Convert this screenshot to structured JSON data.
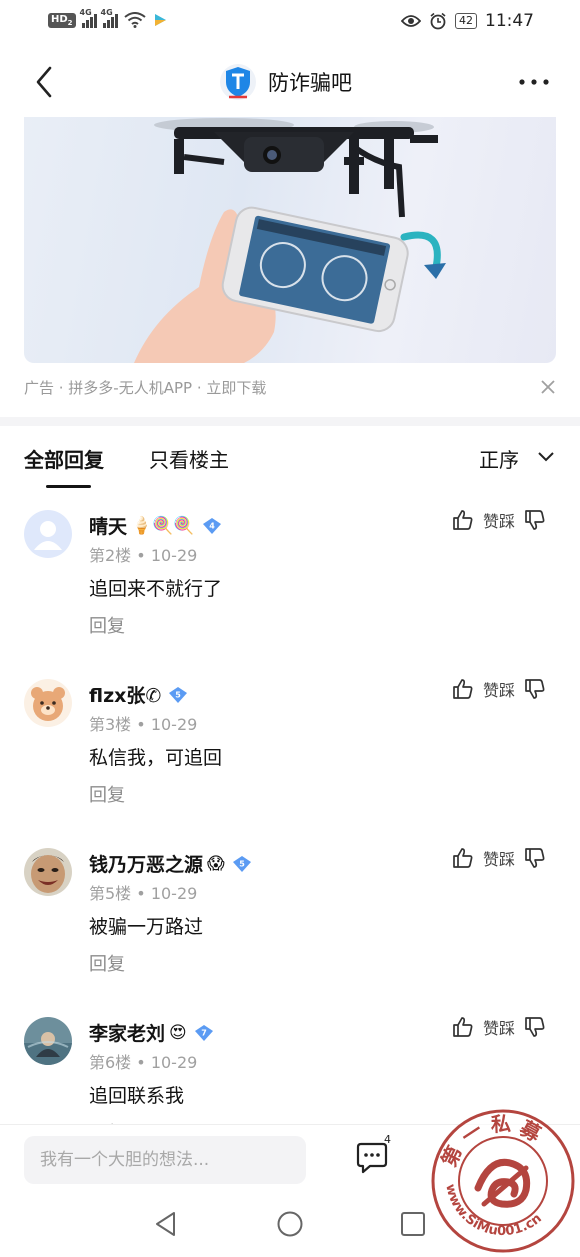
{
  "status_bar": {
    "hd": "HD",
    "hd_sub": "2",
    "net1": "4G",
    "net2": "4G",
    "battery": "42",
    "time": "11:47"
  },
  "header": {
    "title": "防诈骗吧",
    "back_icon": "back-chevron-icon",
    "more_icon": "more-dots-icon"
  },
  "ad": {
    "caption": "广告 · 拼多多-无人机APP · 立即下载",
    "close_icon": "close-icon"
  },
  "tabs": {
    "all": "全部回复",
    "owner_only": "只看楼主",
    "sort": "正序"
  },
  "comments": [
    {
      "username": "晴天",
      "emoji": "🍦🍭🍭",
      "level": "4",
      "floor": "第2楼",
      "date": "10-29",
      "text": "追回来不就行了",
      "reply": "回复",
      "vote_label": "赞踩"
    },
    {
      "username": "flzx张✆",
      "emoji": "",
      "level": "5",
      "floor": "第3楼",
      "date": "10-29",
      "text": "私信我，可追回",
      "reply": "回复",
      "vote_label": "赞踩"
    },
    {
      "username": "钱乃万恶之源",
      "emoji": "😱",
      "level": "5",
      "floor": "第5楼",
      "date": "10-29",
      "text": "被骗一万路过",
      "reply": "回复",
      "vote_label": "赞踩"
    },
    {
      "username": "李家老刘",
      "emoji": "😍",
      "level": "7",
      "floor": "第6楼",
      "date": "10-29",
      "text": "追回联系我",
      "reply": "回复",
      "vote_label": "赞踩"
    }
  ],
  "meta_separator": "•",
  "bottom_bar": {
    "input_placeholder": "我有一个大胆的想法...",
    "comment_count": "4"
  },
  "watermark": {
    "text_top": "第 一 私 募",
    "text_bottom": "www.SiMu001.cn"
  },
  "colors": {
    "level_badge": "#5b9bf3",
    "divider": "#f4f4f6",
    "secondary_text": "#a0a0a0",
    "watermark": "#b4453f"
  }
}
